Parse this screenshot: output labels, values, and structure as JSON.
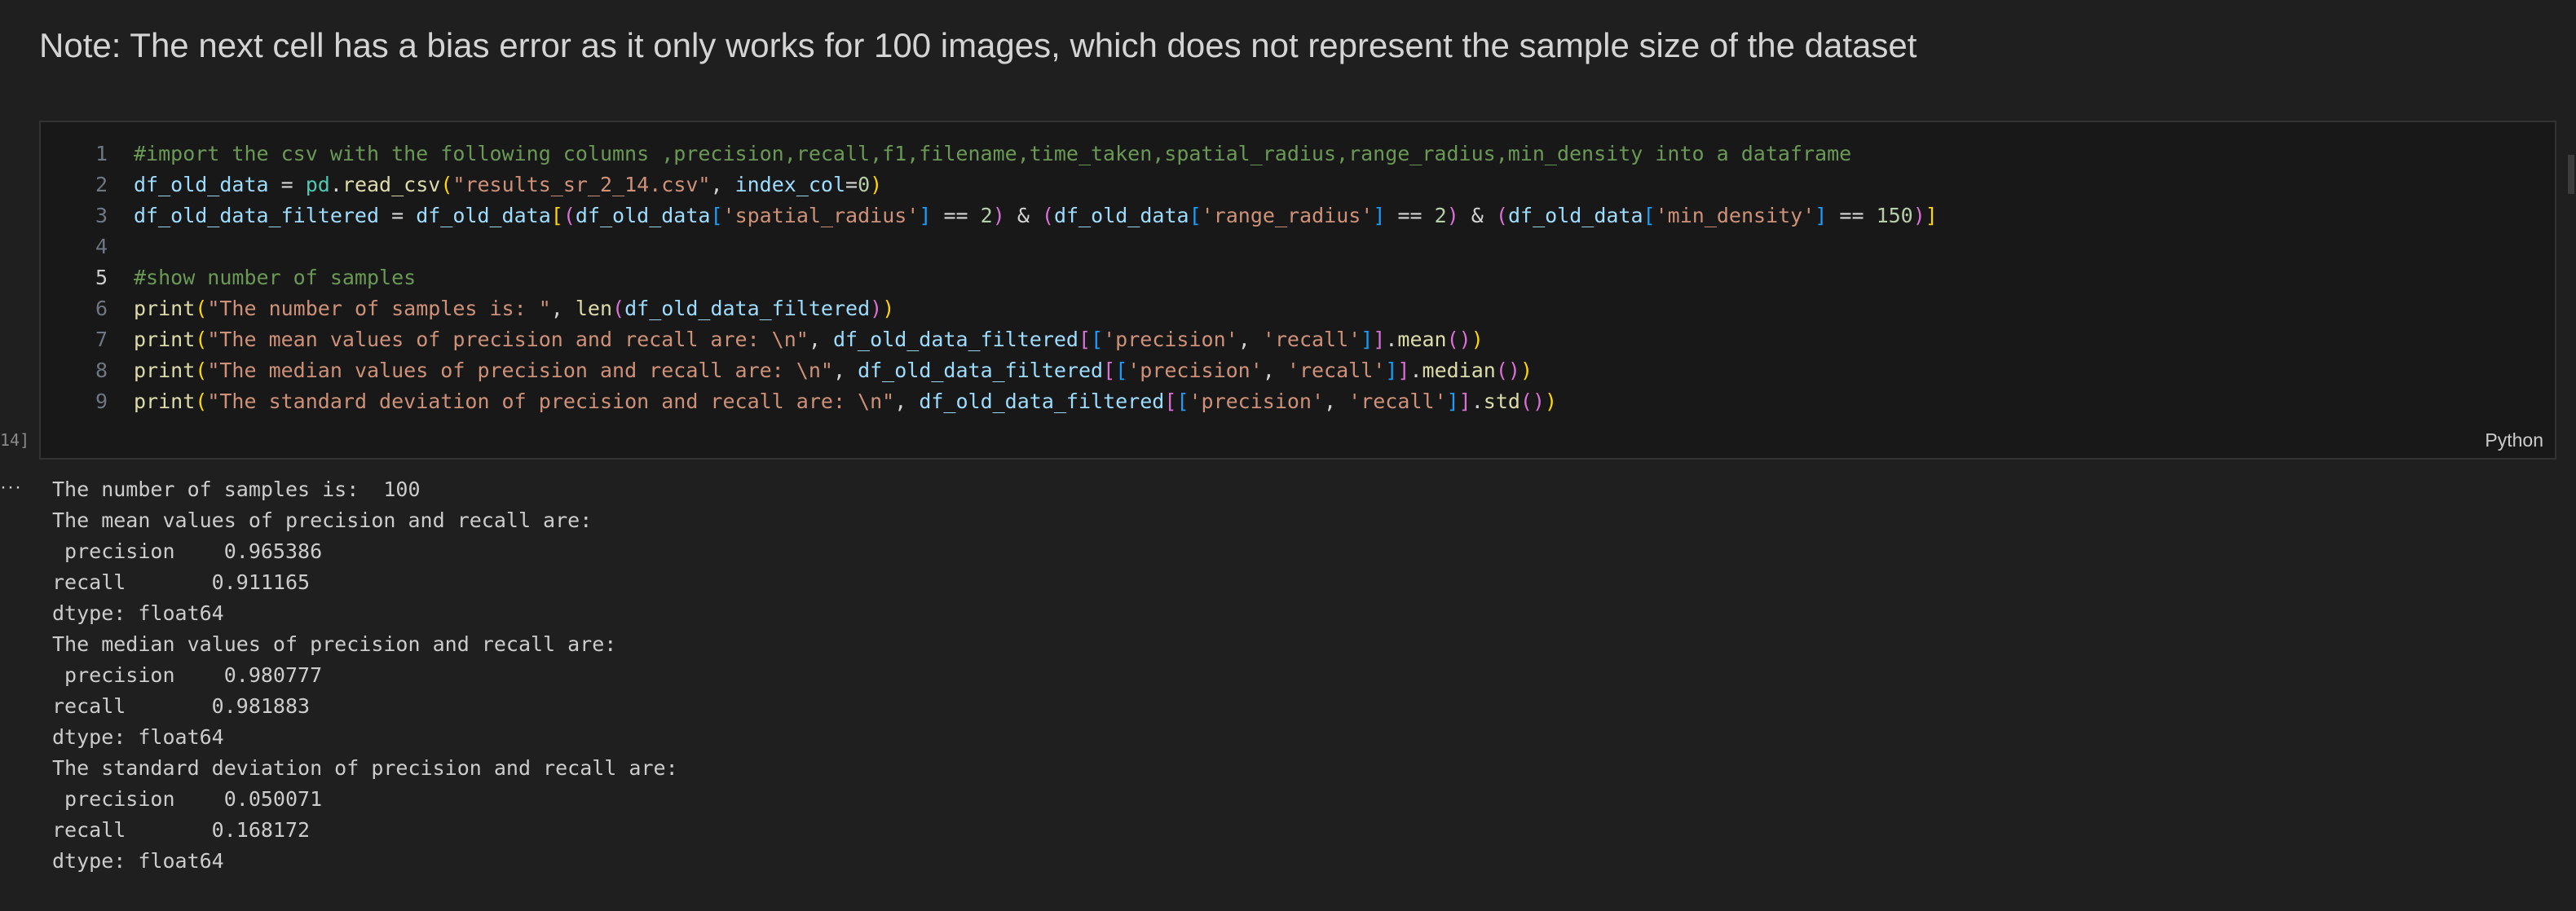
{
  "note": {
    "text": "Note: The next cell has a bias error as it only works for 100 images, which does not represent the sample size of the dataset"
  },
  "cell": {
    "execution_count": "14]",
    "language": "Python",
    "active_line": "5",
    "lines": [
      {
        "number": "1",
        "tokens": [
          {
            "text": "#import the csv with the following columns ,precision,recall,f1,filename,time_taken,spatial_radius,range_radius,min_density into a dataframe",
            "cls": "c-comment"
          }
        ]
      },
      {
        "number": "2",
        "tokens": [
          {
            "text": "df_old_data",
            "cls": "c-var"
          },
          {
            "text": " = ",
            "cls": "c-op"
          },
          {
            "text": "pd",
            "cls": "c-type"
          },
          {
            "text": ".",
            "cls": "c-op"
          },
          {
            "text": "read_csv",
            "cls": "c-func"
          },
          {
            "text": "(",
            "cls": "c-b1"
          },
          {
            "text": "\"results_sr_2_14.csv\"",
            "cls": "c-str"
          },
          {
            "text": ", ",
            "cls": "c-op"
          },
          {
            "text": "index_col",
            "cls": "c-var"
          },
          {
            "text": "=",
            "cls": "c-op"
          },
          {
            "text": "0",
            "cls": "c-num"
          },
          {
            "text": ")",
            "cls": "c-b1"
          }
        ]
      },
      {
        "number": "3",
        "tokens": [
          {
            "text": "df_old_data_filtered",
            "cls": "c-var"
          },
          {
            "text": " = ",
            "cls": "c-op"
          },
          {
            "text": "df_old_data",
            "cls": "c-var"
          },
          {
            "text": "[",
            "cls": "c-b1"
          },
          {
            "text": "(",
            "cls": "c-b2"
          },
          {
            "text": "df_old_data",
            "cls": "c-var"
          },
          {
            "text": "[",
            "cls": "c-b3"
          },
          {
            "text": "'spatial_radius'",
            "cls": "c-str"
          },
          {
            "text": "]",
            "cls": "c-b3"
          },
          {
            "text": " == ",
            "cls": "c-op"
          },
          {
            "text": "2",
            "cls": "c-num"
          },
          {
            "text": ")",
            "cls": "c-b2"
          },
          {
            "text": " & ",
            "cls": "c-op"
          },
          {
            "text": "(",
            "cls": "c-b2"
          },
          {
            "text": "df_old_data",
            "cls": "c-var"
          },
          {
            "text": "[",
            "cls": "c-b3"
          },
          {
            "text": "'range_radius'",
            "cls": "c-str"
          },
          {
            "text": "]",
            "cls": "c-b3"
          },
          {
            "text": " == ",
            "cls": "c-op"
          },
          {
            "text": "2",
            "cls": "c-num"
          },
          {
            "text": ")",
            "cls": "c-b2"
          },
          {
            "text": " & ",
            "cls": "c-op"
          },
          {
            "text": "(",
            "cls": "c-b2"
          },
          {
            "text": "df_old_data",
            "cls": "c-var"
          },
          {
            "text": "[",
            "cls": "c-b3"
          },
          {
            "text": "'min_density'",
            "cls": "c-str"
          },
          {
            "text": "]",
            "cls": "c-b3"
          },
          {
            "text": " == ",
            "cls": "c-op"
          },
          {
            "text": "150",
            "cls": "c-num"
          },
          {
            "text": ")",
            "cls": "c-b2"
          },
          {
            "text": "]",
            "cls": "c-b1"
          }
        ]
      },
      {
        "number": "4",
        "tokens": []
      },
      {
        "number": "5",
        "tokens": [
          {
            "text": "#show number of samples",
            "cls": "c-comment"
          }
        ]
      },
      {
        "number": "6",
        "tokens": [
          {
            "text": "print",
            "cls": "c-func"
          },
          {
            "text": "(",
            "cls": "c-b1"
          },
          {
            "text": "\"The number of samples is: \"",
            "cls": "c-str"
          },
          {
            "text": ", ",
            "cls": "c-op"
          },
          {
            "text": "len",
            "cls": "c-func"
          },
          {
            "text": "(",
            "cls": "c-b2"
          },
          {
            "text": "df_old_data_filtered",
            "cls": "c-var"
          },
          {
            "text": ")",
            "cls": "c-b2"
          },
          {
            "text": ")",
            "cls": "c-b1"
          }
        ]
      },
      {
        "number": "7",
        "tokens": [
          {
            "text": "print",
            "cls": "c-func"
          },
          {
            "text": "(",
            "cls": "c-b1"
          },
          {
            "text": "\"The mean values of precision and recall are: \\n\"",
            "cls": "c-str"
          },
          {
            "text": ", ",
            "cls": "c-op"
          },
          {
            "text": "df_old_data_filtered",
            "cls": "c-var"
          },
          {
            "text": "[",
            "cls": "c-b2"
          },
          {
            "text": "[",
            "cls": "c-b3"
          },
          {
            "text": "'precision'",
            "cls": "c-str"
          },
          {
            "text": ", ",
            "cls": "c-op"
          },
          {
            "text": "'recall'",
            "cls": "c-str"
          },
          {
            "text": "]",
            "cls": "c-b3"
          },
          {
            "text": "]",
            "cls": "c-b2"
          },
          {
            "text": ".",
            "cls": "c-op"
          },
          {
            "text": "mean",
            "cls": "c-func"
          },
          {
            "text": "()",
            "cls": "c-b2"
          },
          {
            "text": ")",
            "cls": "c-b1"
          }
        ]
      },
      {
        "number": "8",
        "tokens": [
          {
            "text": "print",
            "cls": "c-func"
          },
          {
            "text": "(",
            "cls": "c-b1"
          },
          {
            "text": "\"The median values of precision and recall are: \\n\"",
            "cls": "c-str"
          },
          {
            "text": ", ",
            "cls": "c-op"
          },
          {
            "text": "df_old_data_filtered",
            "cls": "c-var"
          },
          {
            "text": "[",
            "cls": "c-b2"
          },
          {
            "text": "[",
            "cls": "c-b3"
          },
          {
            "text": "'precision'",
            "cls": "c-str"
          },
          {
            "text": ", ",
            "cls": "c-op"
          },
          {
            "text": "'recall'",
            "cls": "c-str"
          },
          {
            "text": "]",
            "cls": "c-b3"
          },
          {
            "text": "]",
            "cls": "c-b2"
          },
          {
            "text": ".",
            "cls": "c-op"
          },
          {
            "text": "median",
            "cls": "c-func"
          },
          {
            "text": "()",
            "cls": "c-b2"
          },
          {
            "text": ")",
            "cls": "c-b1"
          }
        ]
      },
      {
        "number": "9",
        "tokens": [
          {
            "text": "print",
            "cls": "c-func"
          },
          {
            "text": "(",
            "cls": "c-b1"
          },
          {
            "text": "\"The standard deviation of precision and recall are: \\n\"",
            "cls": "c-str"
          },
          {
            "text": ", ",
            "cls": "c-op"
          },
          {
            "text": "df_old_data_filtered",
            "cls": "c-var"
          },
          {
            "text": "[",
            "cls": "c-b2"
          },
          {
            "text": "[",
            "cls": "c-b3"
          },
          {
            "text": "'precision'",
            "cls": "c-str"
          },
          {
            "text": ", ",
            "cls": "c-op"
          },
          {
            "text": "'recall'",
            "cls": "c-str"
          },
          {
            "text": "]",
            "cls": "c-b3"
          },
          {
            "text": "]",
            "cls": "c-b2"
          },
          {
            "text": ".",
            "cls": "c-op"
          },
          {
            "text": "std",
            "cls": "c-func"
          },
          {
            "text": "()",
            "cls": "c-b2"
          },
          {
            "text": ")",
            "cls": "c-b1"
          }
        ]
      }
    ]
  },
  "output": {
    "menu_glyph": "···",
    "lines": [
      "The number of samples is:  100",
      "The mean values of precision and recall are: ",
      " precision    0.965386",
      "recall       0.911165",
      "dtype: float64",
      "The median values of precision and recall are: ",
      " precision    0.980777",
      "recall       0.981883",
      "dtype: float64",
      "The standard deviation of precision and recall are: ",
      " precision    0.050071",
      "recall       0.168172",
      "dtype: float64"
    ]
  }
}
